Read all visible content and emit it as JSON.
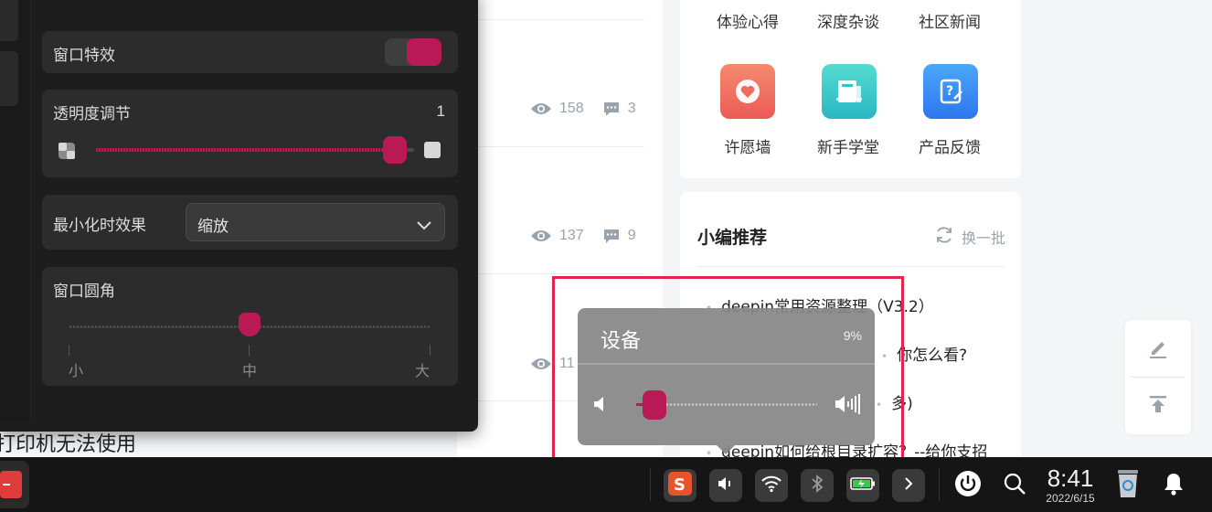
{
  "settings_panel": {
    "window_effects_label": "窗口特效",
    "window_effects_on": true,
    "transparency_label": "透明度调节",
    "transparency_value": "1",
    "transparency_level": 0.94,
    "minimize_effect_label": "最小化时效果",
    "minimize_effect_value": "缩放",
    "corner_label": "窗口圆角",
    "corner_level": 0.5,
    "corner_ticks": {
      "small": "小",
      "medium": "中",
      "large": "大"
    },
    "accent_color": "#b91a55"
  },
  "feed": {
    "posts": [
      {
        "views": "158",
        "comments": "3"
      },
      {
        "views": "137",
        "comments": "9"
      },
      {
        "views": "11"
      }
    ],
    "stray_title": "打印机无法使用"
  },
  "categories": {
    "row1": [
      "体验心得",
      "深度杂谈",
      "社区新闻"
    ],
    "row2": [
      {
        "label": "许愿墙",
        "icon": "heart-icon",
        "color": "#f06b5e"
      },
      {
        "label": "新手学堂",
        "icon": "book-icon",
        "color": "#3cc9c8"
      },
      {
        "label": "产品反馈",
        "icon": "feedback-icon",
        "color": "#3b8ff3"
      }
    ]
  },
  "recommend": {
    "title": "小编推荐",
    "refresh_label": "换一批",
    "items": [
      "deepin常用资源整理（V3.2）",
      "你怎么看?",
      "多)",
      "deepin如何给根目录扩容？--给你支招"
    ]
  },
  "volume_popup": {
    "title": "设备",
    "percent": "9%",
    "level": 0.09
  },
  "taskbar": {
    "time": "8:41",
    "date": "2022/6/15",
    "tray_icons": [
      "sogou-input-icon",
      "volume-icon",
      "wifi-icon",
      "bluetooth-icon",
      "battery-icon",
      "expand-arrow-icon"
    ]
  }
}
